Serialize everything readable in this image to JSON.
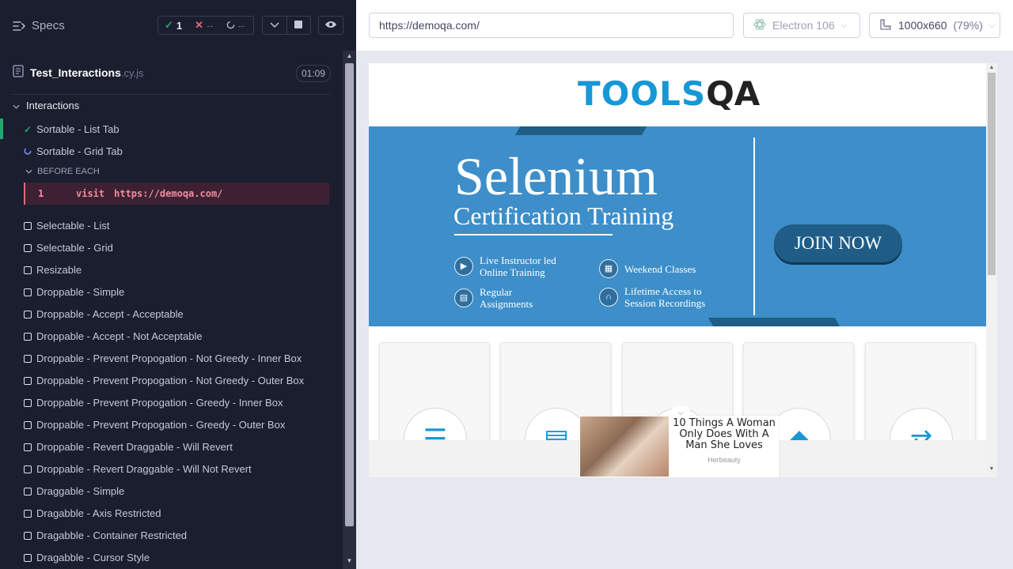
{
  "runner": {
    "specs_label": "Specs",
    "passed_count": "1",
    "failed_count": "--",
    "pending_count": "--",
    "file_name": "Test_Interactions",
    "file_ext": ".cy.js",
    "duration": "01:09",
    "suite_title": "Interactions",
    "hook_label": "BEFORE EACH",
    "command": {
      "index": "1",
      "name": "visit",
      "message": "https://demoqa.com/"
    },
    "passed_test": "Sortable - List Tab",
    "running_test": "Sortable - Grid Tab",
    "pending_tests": [
      "Selectable - List",
      "Selectable - Grid",
      "Resizable",
      "Droppable - Simple",
      "Droppable - Accept - Acceptable",
      "Droppable - Accept - Not Acceptable",
      "Droppable - Prevent Propogation - Not Greedy - Inner Box",
      "Droppable - Prevent Propogation - Not Greedy - Outer Box",
      "Droppable - Prevent Propogation - Greedy - Inner Box",
      "Droppable - Prevent Propogation - Greedy - Outer Box",
      "Droppable - Revert Draggable - Will Revert",
      "Droppable - Revert Draggable - Will Not Revert",
      "Draggable - Simple",
      "Dragabble - Axis Restricted",
      "Dragabble - Container Restricted",
      "Dragabble - Cursor Style"
    ],
    "colors": {
      "background": "#1b1e2e",
      "pass": "#1fa971",
      "fail": "#e0687f"
    }
  },
  "aut": {
    "url": "https://demoqa.com/",
    "browser": "Electron 106",
    "viewport": "1000x660",
    "scale": "(79%)"
  },
  "site": {
    "logo_main": "TOOLS",
    "logo_tail": "QA",
    "banner_title": "Selenium",
    "banner_subtitle": "Certification Training",
    "features": [
      {
        "line1": "Live Instructor led",
        "line2": "Online Training",
        "icon": "play-icon"
      },
      {
        "line1": "Weekend Classes",
        "line2": "",
        "icon": "calendar-icon"
      },
      {
        "line1": "Regular",
        "line2": "Assignments",
        "icon": "document-icon"
      },
      {
        "line1": "Lifetime Access to",
        "line2": "Session Recordings",
        "icon": "headphones-icon"
      }
    ],
    "join_label": "JOIN NOW",
    "card_icons": [
      "elements-icon",
      "forms-icon",
      "alerts-icon",
      "widgets-icon",
      "interactions-icon"
    ],
    "ad": {
      "title": "10 Things A Woman Only Does With A Man She Loves",
      "source": "Herbeauty"
    },
    "colors": {
      "brand": "#1797d6",
      "banner": "#3d8ec9",
      "dark_blue": "#1f5d86"
    }
  }
}
